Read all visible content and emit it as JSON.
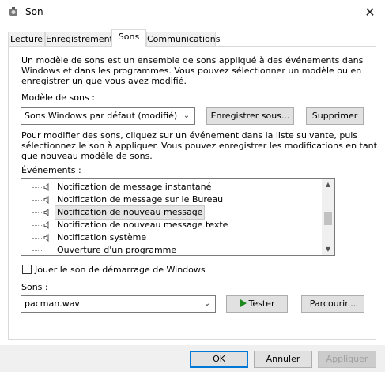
{
  "window": {
    "title": "Son",
    "app_icon": "speaker-icon",
    "close_glyph": "✕"
  },
  "tabs": [
    {
      "label": "Lecture",
      "active": false
    },
    {
      "label": "Enregistrement",
      "active": false
    },
    {
      "label": "Sons",
      "active": true
    },
    {
      "label": "Communications",
      "active": false
    }
  ],
  "sons": {
    "intro": [
      "Un modèle de sons est un ensemble de sons appliqué à des événements dans",
      "Windows et dans les programmes. Vous pouvez sélectionner un modèle ou en",
      "enregistrer un que vous avez modifié."
    ],
    "scheme_label": "Modèle de sons :",
    "scheme_value": "Sons Windows par défaut (modifié)",
    "save_as_label": "Enregistrer sous...",
    "delete_label": "Supprimer",
    "instructions": [
      "Pour modifier des sons, cliquez sur un événement dans la liste suivante, puis",
      "sélectionnez le son à appliquer. Vous pouvez enregistrer les modifications en tant",
      "que nouveau modèle de sons."
    ],
    "events_label": "Événements :",
    "events": [
      {
        "label": "Notification de message instantané",
        "has_sound": true,
        "selected": false
      },
      {
        "label": "Notification de message sur le Bureau",
        "has_sound": true,
        "selected": false
      },
      {
        "label": "Notification de nouveau message",
        "has_sound": true,
        "selected": true
      },
      {
        "label": "Notification de nouveau message texte",
        "has_sound": true,
        "selected": false
      },
      {
        "label": "Notification système",
        "has_sound": true,
        "selected": false
      },
      {
        "label": "Ouverture d'un programme",
        "has_sound": false,
        "selected": false
      }
    ],
    "startup_checkbox_label": "Jouer le son de démarrage de Windows",
    "startup_checked": false,
    "sounds_label": "Sons :",
    "sound_value": "pacman.wav",
    "test_label": "Tester",
    "browse_label": "Parcourir..."
  },
  "footer": {
    "ok_label": "OK",
    "cancel_label": "Annuler",
    "apply_label": "Appliquer"
  },
  "colors": {
    "accent": "#0078d7",
    "play_icon": "#1c8a1c"
  }
}
